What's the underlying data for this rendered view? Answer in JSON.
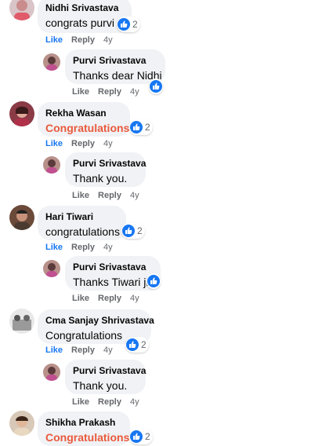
{
  "actions": {
    "like": "Like",
    "reply": "Reply"
  },
  "comments": [
    {
      "name": "Nidhi Srivastava",
      "text": "congrats purvi",
      "time": "4y",
      "reactions": "2",
      "reply": {
        "name": "Purvi Srivastava",
        "text": "Thanks dear Nidhi",
        "time": "4y"
      }
    },
    {
      "name": "Rekha Wasan",
      "text": "Congratulations",
      "time": "4y",
      "reactions": "2",
      "reply": {
        "name": "Purvi Srivastava",
        "text": "Thank you.",
        "time": "4y"
      }
    },
    {
      "name": "Hari Tiwari",
      "text": "congratulations",
      "time": "4y",
      "reactions": "2",
      "reply": {
        "name": "Purvi Srivastava",
        "text": "Thanks Tiwari ji",
        "time": "4y"
      }
    },
    {
      "name": "Cma Sanjay Shrivastava",
      "text": "Congratulations",
      "time": "4y",
      "reactions": "2",
      "reply": {
        "name": "Purvi Srivastava",
        "text": "Thank you.",
        "time": "4y"
      }
    },
    {
      "name": "Shikha Prakash",
      "text": "Congratulations",
      "reactions": "2"
    }
  ],
  "colors": {
    "link_blue": "#1877f2",
    "highlight_orange": "#e9593c",
    "bubble_bg": "#f0f2f5"
  }
}
